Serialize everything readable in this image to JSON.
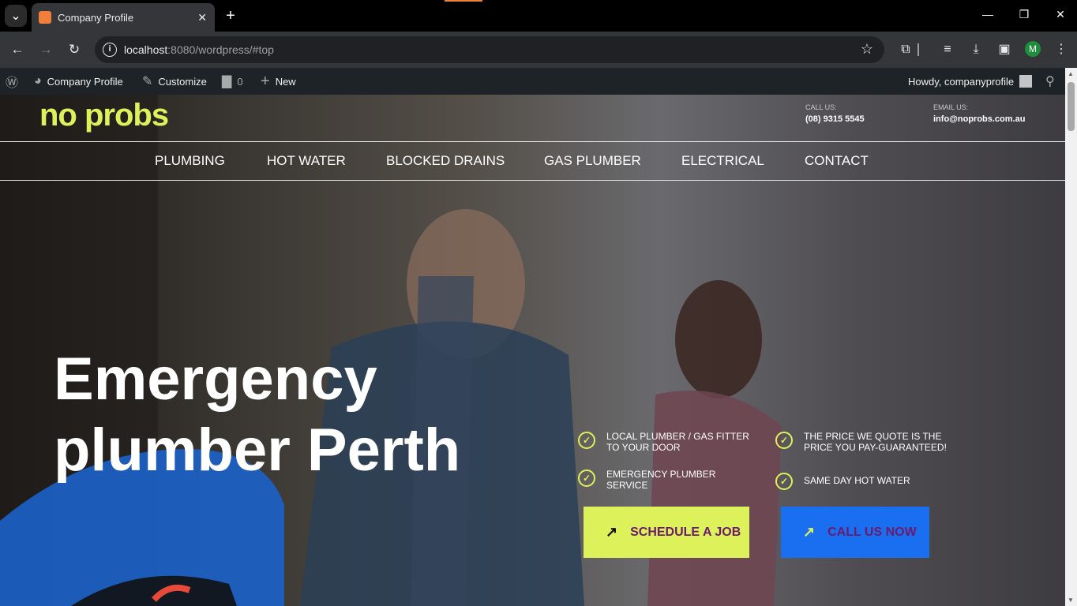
{
  "browser": {
    "tab_title": "Company Profile",
    "url_host": "localhost",
    "url_rest": ":8080/wordpress/#top",
    "profile_initial": "M"
  },
  "wp_admin": {
    "site_name": "Company Profile",
    "customize": "Customize",
    "comments_count": "0",
    "new": "New",
    "greeting": "Howdy, companyprofile"
  },
  "site": {
    "logo": "no probs",
    "call_label": "CALL US:",
    "call_value": "(08) 9315 5545",
    "email_label": "EMAIL US:",
    "email_value": "info@noprobs.com.au",
    "nav": [
      "PLUMBING",
      "HOT WATER",
      "BLOCKED DRAINS",
      "GAS PLUMBER",
      "ELECTRICAL",
      "CONTACT"
    ],
    "hero_line1": "Emergency",
    "hero_line2": "plumber Perth",
    "features": [
      "LOCAL PLUMBER / GAS FITTER TO YOUR DOOR",
      "THE PRICE WE QUOTE IS THE PRICE YOU PAY-GUARANTEED!",
      "EMERGENCY PLUMBER SERVICE",
      "SAME DAY HOT WATER"
    ],
    "btn_schedule": "SCHEDULE A JOB",
    "btn_call": "CALL US NOW"
  },
  "colors": {
    "accent_lime": "#ddf25a",
    "accent_blue": "#1a6ff0",
    "button_text": "#6a1b6e"
  }
}
